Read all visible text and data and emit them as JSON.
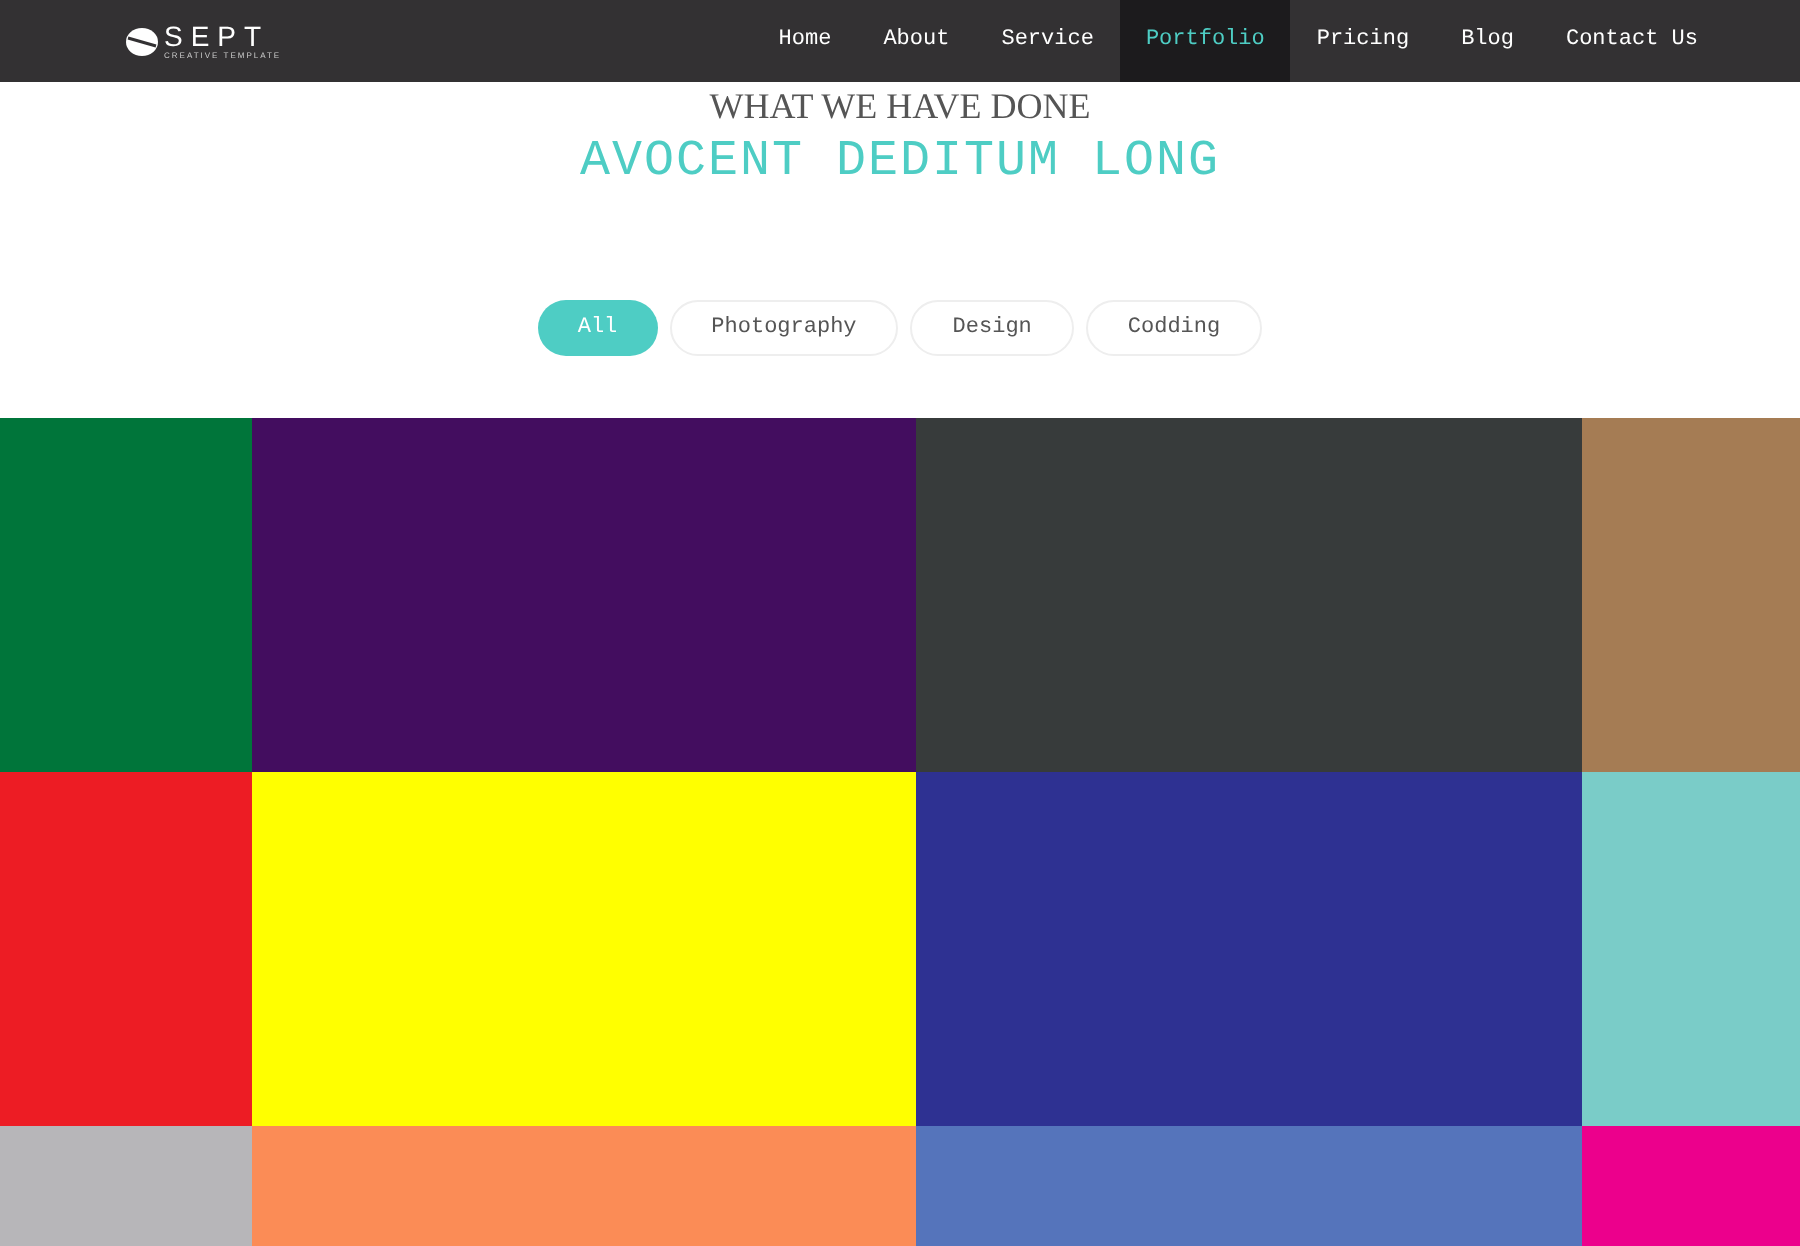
{
  "header": {
    "logo": {
      "name": "SEPT",
      "tagline": "CREATIVE TEMPLATE"
    },
    "nav": [
      {
        "label": "Home",
        "selected": false
      },
      {
        "label": "About",
        "selected": false
      },
      {
        "label": "Service",
        "selected": false
      },
      {
        "label": "Portfolio",
        "selected": true
      },
      {
        "label": "Pricing",
        "selected": false
      },
      {
        "label": "Blog",
        "selected": false
      },
      {
        "label": "Contact Us",
        "selected": false
      }
    ]
  },
  "section": {
    "kicker": "WHAT WE HAVE DONE",
    "title": "AVOCENT DEDITUM LONG"
  },
  "filters": [
    {
      "label": "All",
      "selected": true
    },
    {
      "label": "Photography",
      "selected": false
    },
    {
      "label": "Design",
      "selected": false
    },
    {
      "label": "Codding",
      "selected": false
    }
  ],
  "tiles": [
    {
      "color": "#00753a"
    },
    {
      "color": "#430d5f"
    },
    {
      "color": "#373b3b"
    },
    {
      "color": "#a57c54"
    },
    {
      "color": "#ed1c24"
    },
    {
      "color": "#ffff00"
    },
    {
      "color": "#2e3192"
    },
    {
      "color": "#7accc8"
    },
    {
      "color": "#b7b6b9"
    },
    {
      "color": "#fb8c56"
    },
    {
      "color": "#5574bb"
    },
    {
      "color": "#ec008c"
    }
  ]
}
